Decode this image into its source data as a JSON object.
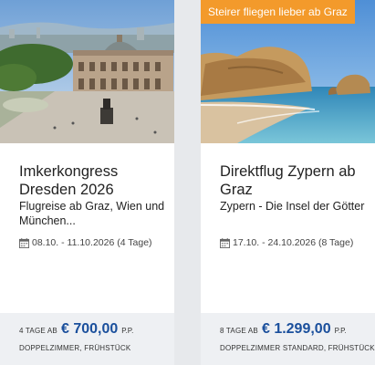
{
  "cards": [
    {
      "title": "Imkerkongress Dresden 2026",
      "subtitle": "Flugreise ab Graz, Wien und München...",
      "dates": "08.10. - 11.10.2026 (4 Tage)",
      "price_prefix": "4 TAGE AB",
      "price": "€ 700,00",
      "price_suffix": "P.P.",
      "room": "DOPPELZIMMER, FRÜHSTÜCK"
    },
    {
      "tag": "Steirer fliegen lieber ab Graz",
      "title": "Direktflug Zypern ab Graz",
      "subtitle": "Zypern - Die Insel der Götter",
      "dates": "17.10. - 24.10.2026 (8 Tage)",
      "price_prefix": "8 TAGE AB",
      "price": "€ 1.299,00",
      "price_suffix": "P.P.",
      "room": "DOPPELZIMMER STANDARD, FRÜHSTÜCK"
    }
  ],
  "colors": {
    "accent": "#1a4f9c",
    "tag": "#f39a2b"
  },
  "icons": {
    "dates": "calendar-icon"
  }
}
